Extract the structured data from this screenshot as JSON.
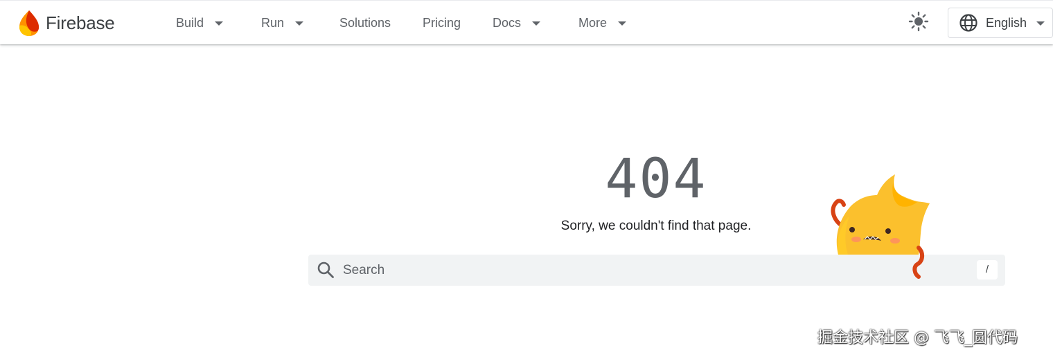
{
  "brand": {
    "name": "Firebase",
    "logo_icon": "firebase-flame-logo"
  },
  "nav": {
    "items": [
      {
        "label": "Build",
        "has_dropdown": true
      },
      {
        "label": "Run",
        "has_dropdown": true
      },
      {
        "label": "Solutions",
        "has_dropdown": false
      },
      {
        "label": "Pricing",
        "has_dropdown": false
      },
      {
        "label": "Docs",
        "has_dropdown": true
      },
      {
        "label": "More",
        "has_dropdown": true
      }
    ]
  },
  "header_actions": {
    "theme_icon": "sun-icon",
    "language": {
      "icon": "globe-icon",
      "label": "English"
    }
  },
  "error": {
    "code": "404",
    "message": "Sorry, we couldn't find that page."
  },
  "search": {
    "placeholder": "Search",
    "value": "",
    "shortcut_key": "/"
  },
  "watermark": {
    "text": "掘金技术社区 @ 飞飞_圆代码"
  },
  "colors": {
    "text_primary": "#202124",
    "text_secondary": "#5f6368",
    "search_bg": "#f1f3f4",
    "mascot_yellow": "#fbc02d",
    "flame_orange": "#ff8f00",
    "flame_red": "#dd2c00"
  }
}
